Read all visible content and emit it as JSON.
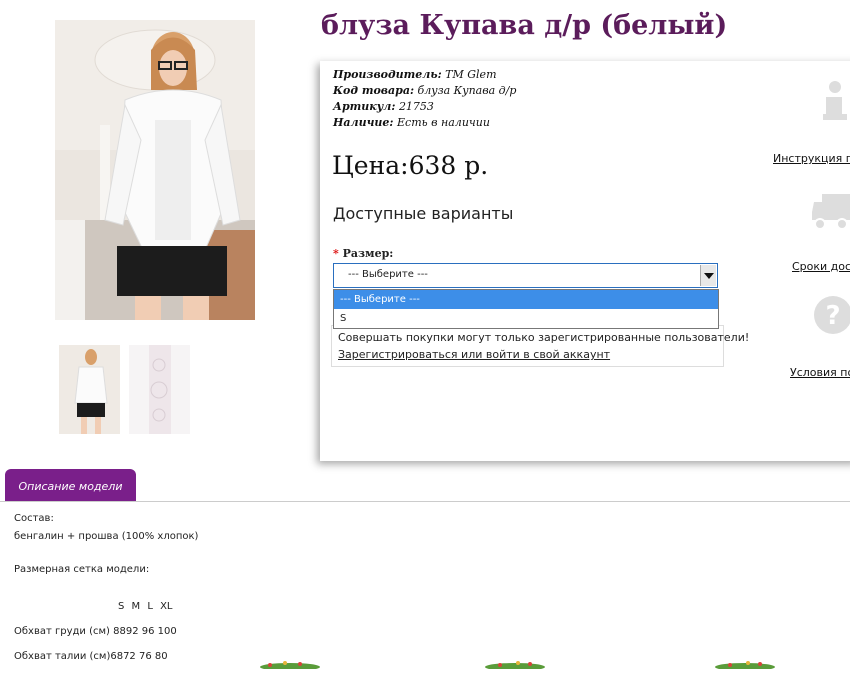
{
  "product": {
    "title": "блуза Купава д/р (белый)",
    "images": {
      "main": "product-photo-white-blouse",
      "thumbs": [
        "thumb-model",
        "thumb-lace-detail"
      ]
    }
  },
  "specs": [
    {
      "label": "Производитель:",
      "value": "ТМ Glem"
    },
    {
      "label": "Код товара:",
      "value": "блуза Купава д/р"
    },
    {
      "label": "Артикул:",
      "value": "21753"
    },
    {
      "label": "Наличие:",
      "value": "Есть в наличии"
    }
  ],
  "price": "Цена:638 р.",
  "variants_heading": "Доступные варианты",
  "size": {
    "required_mark": "*",
    "label": "Размер:",
    "selected": "--- Выберите ---",
    "options": [
      "--- Выберите ---",
      "S"
    ]
  },
  "notice": {
    "text": "Совершать покупки могут только зарегистрированные пользователи!",
    "link": "Зарегистрироваться или войти в свой аккаунт"
  },
  "side_links": [
    {
      "icon": "info-icon",
      "label": "Инструкция по"
    },
    {
      "icon": "truck-icon",
      "label": "Сроки дост"
    },
    {
      "icon": "question-icon",
      "label": "Условия по"
    }
  ],
  "tab": {
    "label": "Описание модели"
  },
  "description": {
    "composition_label": "Состав:",
    "composition_value": "бенгалин + прошва (100% хлопок)",
    "size_chart_label": "Размерная сетка модели:",
    "size_chart_header": "S M L XL",
    "rows": [
      "Обхват груди (см) 8892 96 100",
      "Обхват талии (см)6872 76 80"
    ]
  },
  "colors": {
    "title": "#5b1c5b",
    "tab": "#7a1f8a",
    "dropdown_highlight": "#3d8ee8",
    "required": "#dd1111",
    "icon": "#dddddd"
  }
}
